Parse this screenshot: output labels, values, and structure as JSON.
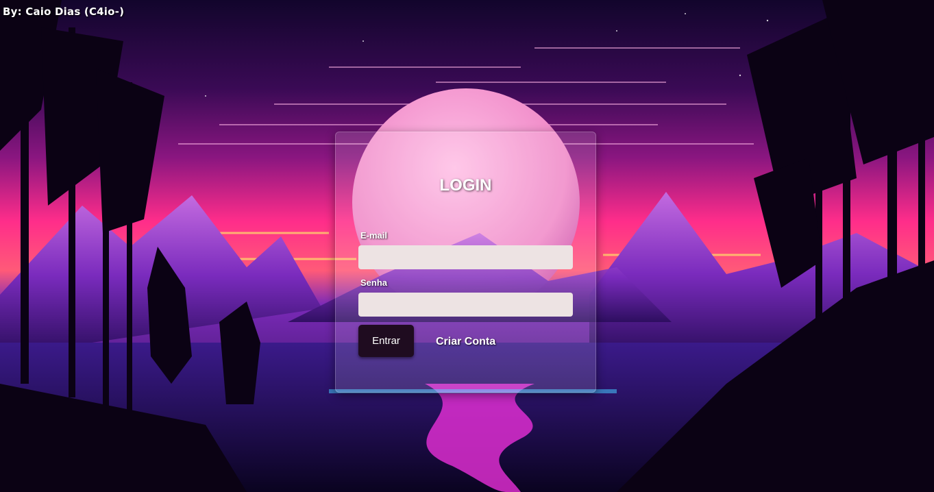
{
  "credit": "By: Caio Dias (C4io-)",
  "login": {
    "title": "LOGIN",
    "email_label": "E-mail",
    "email_value": "",
    "password_label": "Senha",
    "password_value": "",
    "submit_label": "Entrar",
    "create_account_label": "Criar Conta"
  },
  "colors": {
    "sky_top": "#1a0636",
    "sky_horizon": "#ff2d8a",
    "moon": "#f08ac8",
    "mountains": "#8a2fc4",
    "input_bg": "#ede3e3",
    "button_bg": "#1f0c20"
  }
}
